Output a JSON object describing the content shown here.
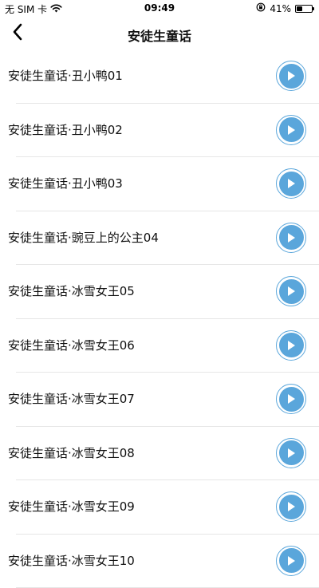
{
  "status_bar": {
    "carrier": "无 SIM 卡",
    "wifi_icon": "wifi-icon",
    "time": "09:49",
    "orientation_lock_icon": "orientation-lock-icon",
    "battery_percent": "41%",
    "battery_level": 0.41
  },
  "nav": {
    "back_icon": "chevron-left-icon",
    "title": "安徒生童话"
  },
  "list": {
    "accent_color": "#5aa6db",
    "items": [
      {
        "title": "安徒生童话·丑小鸭01"
      },
      {
        "title": "安徒生童话·丑小鸭02"
      },
      {
        "title": "安徒生童话·丑小鸭03"
      },
      {
        "title": "安徒生童话·豌豆上的公主04"
      },
      {
        "title": "安徒生童话·冰雪女王05"
      },
      {
        "title": "安徒生童话·冰雪女王06"
      },
      {
        "title": "安徒生童话·冰雪女王07"
      },
      {
        "title": "安徒生童话·冰雪女王08"
      },
      {
        "title": "安徒生童话·冰雪女王09"
      },
      {
        "title": "安徒生童话·冰雪女王10"
      }
    ]
  }
}
